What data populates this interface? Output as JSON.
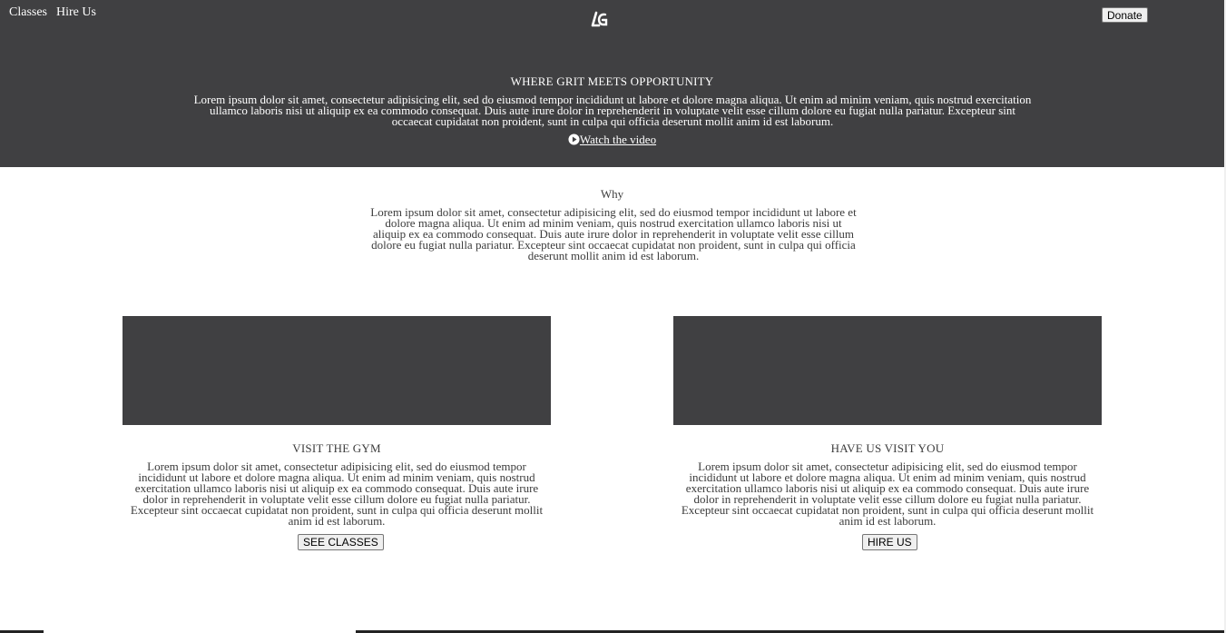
{
  "nav": {
    "classes_label": "Classes",
    "hire_label": "Hire Us"
  },
  "header": {
    "logo_text": "LG",
    "donate_label": "Donate"
  },
  "hero": {
    "title": "WHERE GRIT MEETS OPPORTUNITY",
    "text": "Lorem ipsum dolor sit amet, consectetur adipisicing elit, sed do eiusmod tempor incididunt ut labore et dolore magna aliqua. Ut enim ad minim veniam, quis nostrud exercitation ullamco laboris nisi ut aliquip ex ea commodo consequat. Duis aute irure dolor in reprehenderit in voluptate velit esse cillum dolore eu fugiat nulla pariatur. Excepteur sint occaecat cupidatat non proident, sunt in culpa qui officia deserunt mollit anim id est laborum.",
    "watch_label": "Watch the video"
  },
  "why": {
    "title": "Why",
    "text": "Lorem ipsum dolor sit amet, consectetur adipisicing elit, sed do eiusmod tempor incididunt ut labore et dolore magna aliqua. Ut enim ad minim veniam, quis nostrud exercitation ullamco laboris nisi ut aliquip ex ea commodo consequat. Duis aute irure dolor in reprehenderit in voluptate velit esse cillum dolore eu fugiat nulla pariatur. Excepteur sint occaecat cupidatat non proident, sunt in culpa qui officia deserunt mollit anim id est laborum."
  },
  "cards": [
    {
      "title": "VISIT THE GYM",
      "text": "Lorem ipsum dolor sit amet, consectetur adipisicing elit, sed do eiusmod tempor incididunt ut labore et dolore magna aliqua. Ut enim ad minim veniam, quis nostrud exercitation ullamco laboris nisi ut aliquip ex ea commodo consequat. Duis aute irure dolor in reprehenderit in voluptate velit esse cillum dolore eu fugiat nulla pariatur. Excepteur sint occaecat cupidatat non proident, sunt in culpa qui officia deserunt mollit anim id est laborum.",
      "button": "SEE CLASSES"
    },
    {
      "title": "HAVE US VISIT YOU",
      "text": "Lorem ipsum dolor sit amet, consectetur adipisicing elit, sed do eiusmod tempor incididunt ut labore et dolore magna aliqua. Ut enim ad minim veniam, quis nostrud exercitation ullamco laboris nisi ut aliquip ex ea commodo consequat. Duis aute irure dolor in reprehenderit in voluptate velit esse cillum dolore eu fugiat nulla pariatur. Excepteur sint occaecat cupidatat non proident, sunt in culpa qui officia deserunt mollit anim id est laborum.",
      "button": "HIRE US"
    }
  ],
  "colors": {
    "hero_background": "#404042",
    "card_image_background": "#404042",
    "text": "#3c3c3c"
  }
}
